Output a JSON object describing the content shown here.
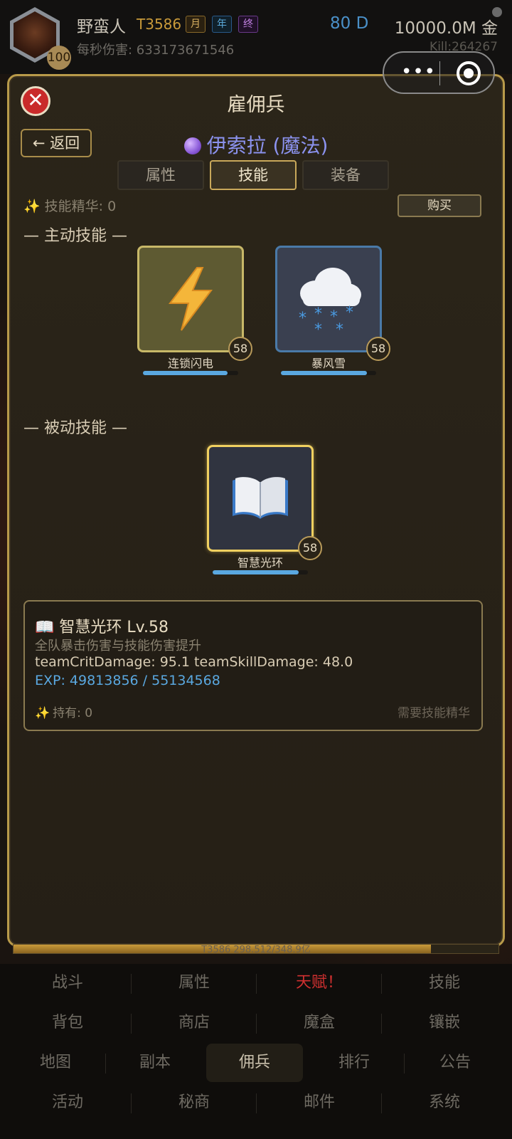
{
  "player": {
    "name": "野蛮人",
    "tier": "T3586",
    "tags": [
      "月",
      "年",
      "终"
    ],
    "level": "100",
    "dps_label": "每秒伤害: 633173671546",
    "diamond": "80 D",
    "gold": "10000.0M 金",
    "kill": "Kill:264267"
  },
  "modal": {
    "title": "雇佣兵",
    "back_label": "← 返回",
    "merc_name": "伊索拉 (魔法)",
    "tabs": [
      "属性",
      "技能",
      "装备"
    ],
    "active_tab": "技能",
    "essence_label": "技能精华: 0",
    "buy_label": "购买",
    "active_section": "— 主动技能 —",
    "passive_section": "— 被动技能 —",
    "active_skills": [
      {
        "name": "连锁闪电",
        "level": "58",
        "icon": "lightning-icon",
        "exp_progress": 0.89
      },
      {
        "name": "暴风雪",
        "level": "58",
        "icon": "snow-cloud-icon",
        "exp_progress": 0.9
      }
    ],
    "passive_skills": [
      {
        "name": "智慧光环",
        "level": "58",
        "icon": "open-book-icon",
        "exp_progress": 0.9,
        "selected": true
      }
    ],
    "detail": {
      "title": "智慧光环  Lv.58",
      "description": "全队暴击伤害与技能伤害提升",
      "stats": "teamCritDamage: 95.1  teamSkillDamage: 48.0",
      "exp": "EXP: 49813856 / 55134568",
      "owned": "持有: 0",
      "need": "需要技能精华"
    }
  },
  "progress_strip": {
    "text": "T3586  298.512/348.9亿",
    "progress": 0.86
  },
  "bottom_nav": {
    "rows": [
      [
        "战斗",
        "属性",
        "天赋！",
        "技能"
      ],
      [
        "背包",
        "商店",
        "魔盒",
        "镶嵌"
      ],
      [
        "地图",
        "副本",
        "佣兵",
        "排行",
        "公告"
      ],
      [
        "活动",
        "秘商",
        "邮件",
        "系统"
      ]
    ],
    "active": "佣兵",
    "alert": "天赋！"
  },
  "colors": {
    "accent_gold": "#c9a85a",
    "merc_name": "#8b92ee",
    "exp_blue": "#5aa8e0",
    "alert_red": "#d03030"
  }
}
